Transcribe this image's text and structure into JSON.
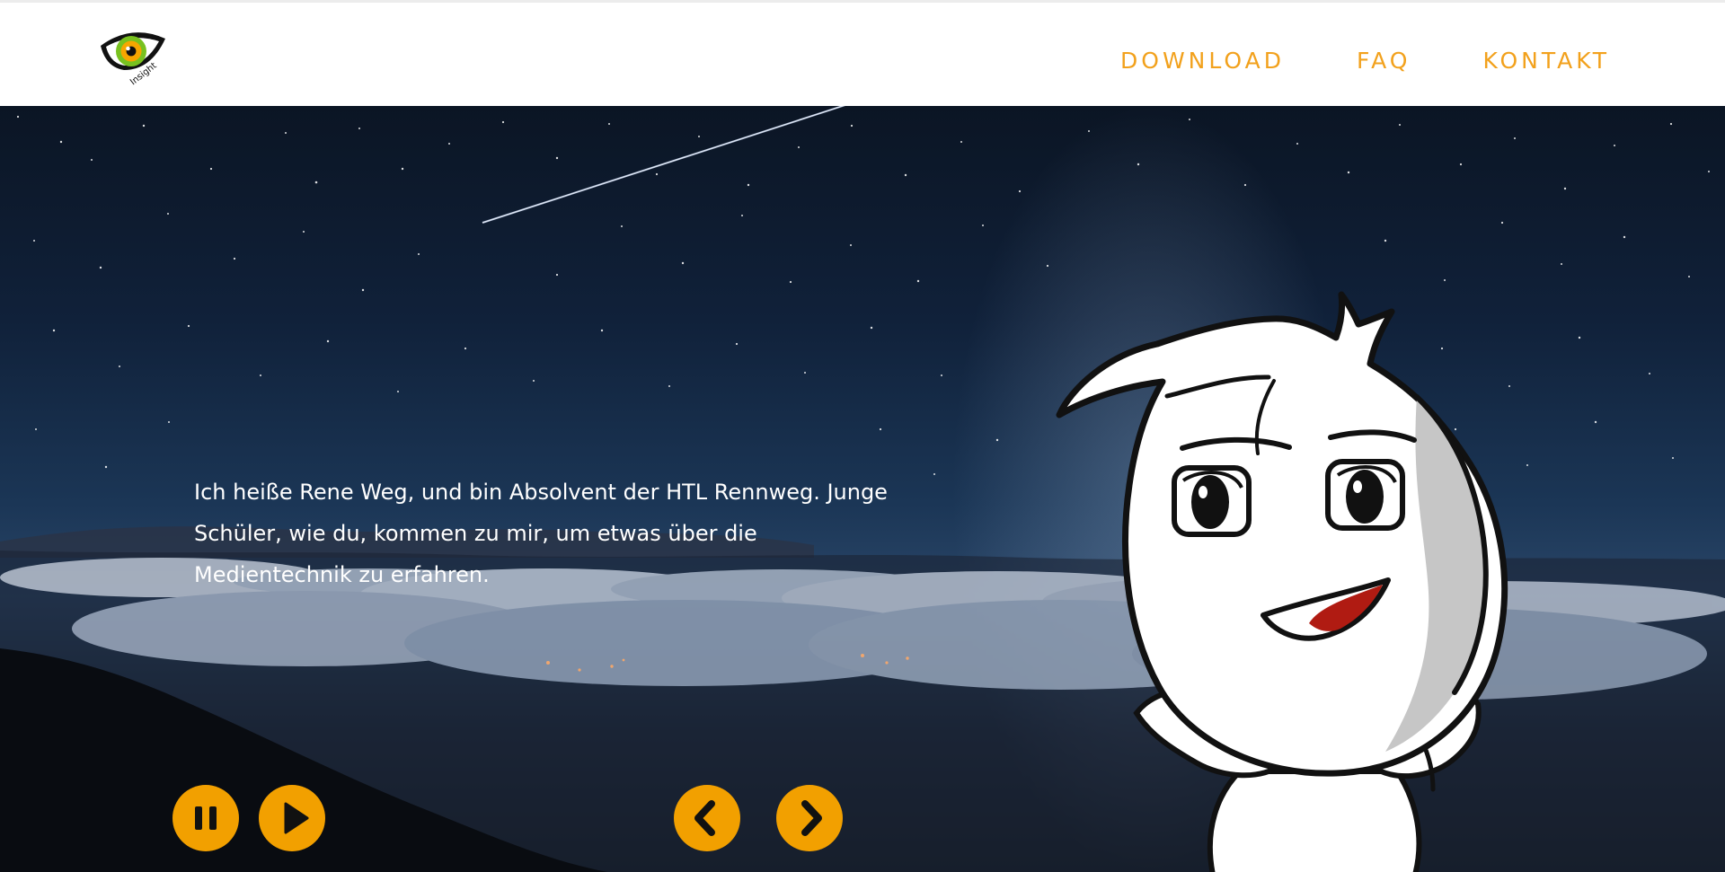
{
  "header": {
    "logo_alt": "Insight",
    "logo_text": "Insight",
    "nav": [
      {
        "label": "DOWNLOAD"
      },
      {
        "label": "FAQ"
      },
      {
        "label": "KONTAKT"
      }
    ]
  },
  "hero": {
    "text_lines": [
      "Ich heiße Rene Weg, und bin Absolvent der HTL Rennweg. Junge",
      "Schüler, wie du, kommen zu mir, um etwas über die",
      "Medientechnik zu erfahren."
    ],
    "controls": {
      "pause_icon": "pause-icon",
      "play_icon": "play-icon",
      "prev_icon": "chevron-left-icon",
      "next_icon": "chevron-right-icon"
    }
  },
  "colors": {
    "accent": "#f2a11c",
    "button_bg": "#f2a000",
    "mouth": "#b01b12"
  }
}
